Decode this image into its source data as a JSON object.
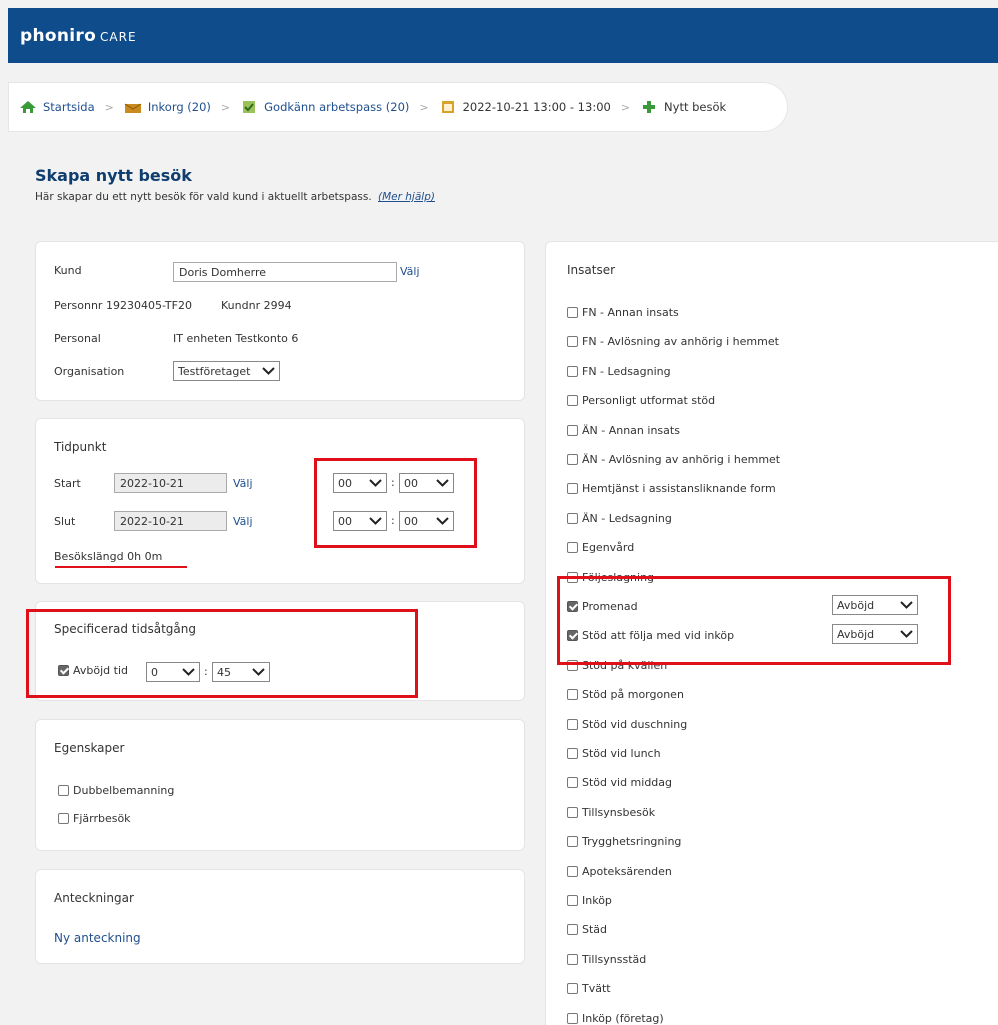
{
  "header": {
    "brand": "phoniro",
    "brand_suffix": "CARE",
    "bg_color": "#0e4c8c"
  },
  "breadcrumb": [
    {
      "label": "Startsida",
      "icon": "home-icon"
    },
    {
      "label": "Inkorg (20)",
      "icon": "inbox-icon"
    },
    {
      "label": "Godkänn arbetspass (20)",
      "icon": "approve-icon"
    },
    {
      "label": "2022-10-21 13:00 - 13:00",
      "icon": "calendar-icon"
    },
    {
      "label": "Nytt besök",
      "icon": "plus-icon"
    }
  ],
  "page": {
    "title": "Skapa nytt besök",
    "subtitle": "Här skapar du ett nytt besök för vald kund i aktuellt arbetspass.",
    "help_link": "(Mer hjälp)"
  },
  "customer": {
    "kund_label": "Kund",
    "kund_value": "Doris Domherre",
    "valj": "Välj",
    "personnr_label": "Personnr",
    "personnr_value": "19230405-TF20",
    "kundnr_label": "Kundnr",
    "kundnr_value": "2994",
    "personal_label": "Personal",
    "personal_value": "IT enheten Testkonto 6",
    "org_label": "Organisation",
    "org_value": "Testföretaget"
  },
  "time": {
    "title": "Tidpunkt",
    "start_label": "Start",
    "start_date": "2022-10-21",
    "slut_label": "Slut",
    "slut_date": "2022-10-21",
    "valj": "Välj",
    "start_hour": "00",
    "start_min": "00",
    "slut_hour": "00",
    "slut_min": "00",
    "colon": ":",
    "length_label": "Besökslängd",
    "length_value": "0h 0m"
  },
  "spec": {
    "title": "Specificerad tidsåtgång",
    "checkbox_label": "Avböjd tid",
    "checked": true,
    "hours": "0",
    "minutes": "45",
    "colon": ":"
  },
  "properties": {
    "title": "Egenskaper",
    "items": [
      {
        "label": "Dubbelbemanning",
        "checked": false
      },
      {
        "label": "Fjärrbesök",
        "checked": false
      }
    ]
  },
  "notes": {
    "title": "Anteckningar",
    "link": "Ny anteckning"
  },
  "insatser": {
    "title": "Insatser",
    "items": [
      {
        "label": "FN - Annan insats",
        "checked": false
      },
      {
        "label": "FN - Avlösning av anhörig i hemmet",
        "checked": false
      },
      {
        "label": "FN - Ledsagning",
        "checked": false
      },
      {
        "label": "Personligt utformat stöd",
        "checked": false
      },
      {
        "label": "ÄN - Annan insats",
        "checked": false
      },
      {
        "label": "ÄN - Avlösning av anhörig i hemmet",
        "checked": false
      },
      {
        "label": "Hemtjänst i assistansliknande form",
        "checked": false
      },
      {
        "label": "ÄN - Ledsagning",
        "checked": false
      },
      {
        "label": "Egenvård",
        "checked": false
      },
      {
        "label": "Följeslagning",
        "checked": false
      },
      {
        "label": "Promenad",
        "checked": true,
        "status": "Avböjd"
      },
      {
        "label": "Stöd att följa med vid inköp",
        "checked": true,
        "status": "Avböjd"
      },
      {
        "label": "Stöd på kvällen",
        "checked": false
      },
      {
        "label": "Stöd på morgonen",
        "checked": false
      },
      {
        "label": "Stöd vid duschning",
        "checked": false
      },
      {
        "label": "Stöd vid lunch",
        "checked": false
      },
      {
        "label": "Stöd vid middag",
        "checked": false
      },
      {
        "label": "Tillsynsbesök",
        "checked": false
      },
      {
        "label": "Trygghetsringning",
        "checked": false
      },
      {
        "label": "Apoteksärenden",
        "checked": false
      },
      {
        "label": "Inköp",
        "checked": false
      },
      {
        "label": "Städ",
        "checked": false
      },
      {
        "label": "Tillsynsstäd",
        "checked": false
      },
      {
        "label": "Tvätt",
        "checked": false
      },
      {
        "label": "Inköp (företag)",
        "checked": false
      }
    ]
  },
  "annotation_color": "#e0101a"
}
